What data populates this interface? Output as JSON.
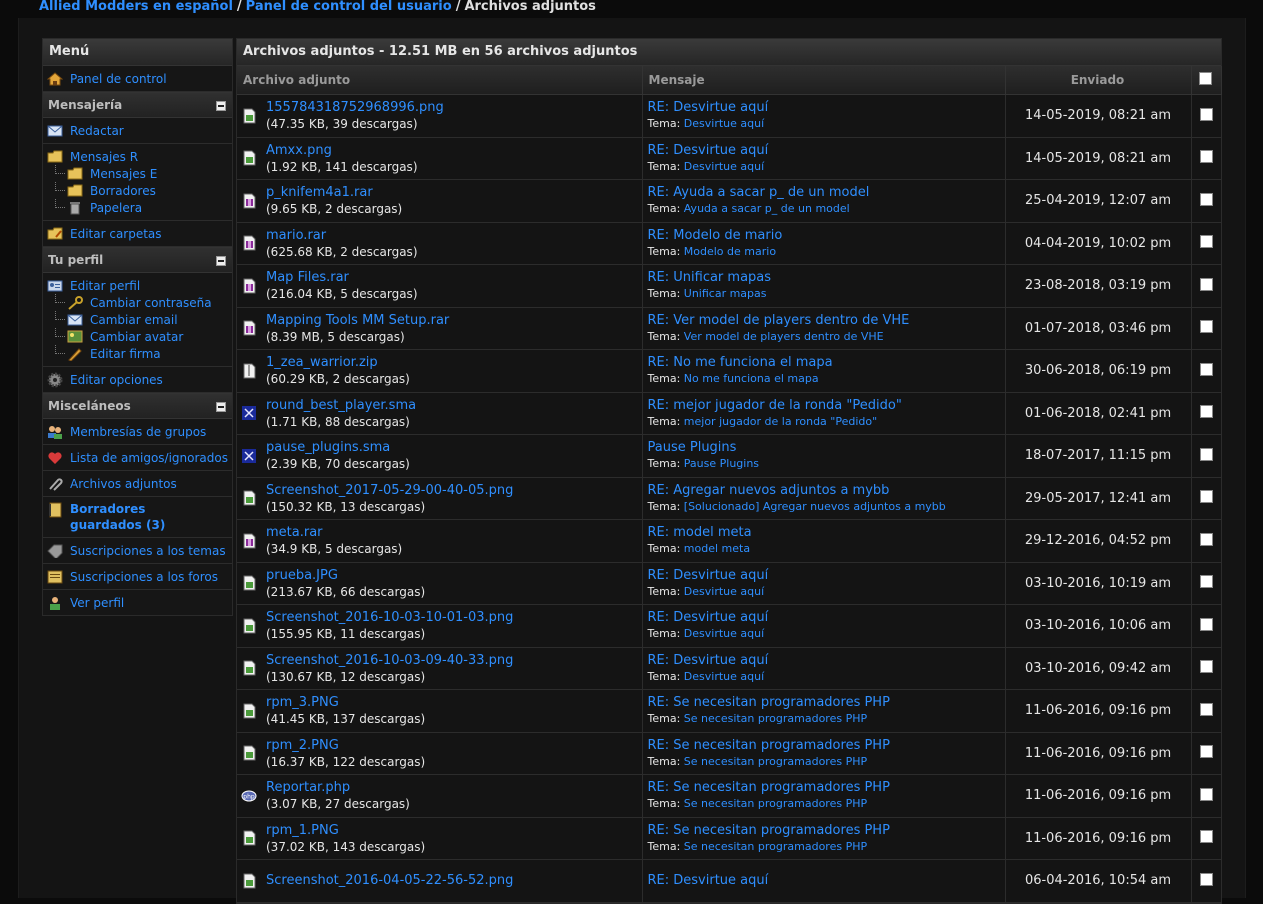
{
  "breadcrumb": [
    "Allied Modders en español",
    "Panel de control del usuario",
    "Archivos adjuntos"
  ],
  "sidebar": {
    "title": "Menú",
    "panel": "Panel de control",
    "messaging": {
      "title": "Mensajería",
      "compose": "Redactar",
      "inbox": "Mensajes R",
      "sent": "Mensajes E",
      "drafts": "Borradores",
      "trash": "Papelera",
      "edit_folders": "Editar carpetas"
    },
    "profile": {
      "title": "Tu perfil",
      "edit_profile": "Editar perfil",
      "change_password": "Cambiar contraseña",
      "change_email": "Cambiar email",
      "change_avatar": "Cambiar avatar",
      "edit_signature": "Editar firma",
      "edit_options": "Editar opciones"
    },
    "misc": {
      "title": "Misceláneos",
      "group_memberships": "Membresías de grupos",
      "friends": "Lista de amigos/ignorados",
      "attachments": "Archivos adjuntos",
      "saved_drafts": "Borradores guardados (3)",
      "thread_subs": "Suscripciones a los temas",
      "forum_subs": "Suscripciones a los foros",
      "view_profile": "Ver perfil"
    }
  },
  "main": {
    "title": "Archivos adjuntos - 12.51 MB en 56 archivos adjuntos",
    "columns": {
      "file": "Archivo adjunto",
      "message": "Mensaje",
      "sent": "Enviado"
    },
    "topic_label": "Tema:",
    "rows": [
      {
        "icon": "image",
        "name": "155784318752968996.png",
        "meta": "(47.35 KB, 39 descargas)",
        "message": "RE: Desvirtue aquí",
        "topic": "Desvirtue aquí",
        "date": "14-05-2019, 08:21 am"
      },
      {
        "icon": "image",
        "name": "Amxx.png",
        "meta": "(1.92 KB, 141 descargas)",
        "message": "RE: Desvirtue aquí",
        "topic": "Desvirtue aquí",
        "date": "14-05-2019, 08:21 am"
      },
      {
        "icon": "archive",
        "name": "p_knifem4a1.rar",
        "meta": "(9.65 KB, 2 descargas)",
        "message": "RE: Ayuda a sacar p_ de un model",
        "topic": "Ayuda a sacar p_ de un model",
        "date": "25-04-2019, 12:07 am"
      },
      {
        "icon": "archive",
        "name": "mario.rar",
        "meta": "(625.68 KB, 2 descargas)",
        "message": "RE: Modelo de mario",
        "topic": "Modelo de mario",
        "date": "04-04-2019, 10:02 pm"
      },
      {
        "icon": "archive",
        "name": "Map Files.rar",
        "meta": "(216.04 KB, 5 descargas)",
        "message": "RE: Unificar mapas",
        "topic": "Unificar mapas",
        "date": "23-08-2018, 03:19 pm"
      },
      {
        "icon": "archive",
        "name": "Mapping Tools MM Setup.rar",
        "meta": "(8.39 MB, 5 descargas)",
        "message": "RE: Ver model de players dentro de VHE",
        "topic": "Ver model de players dentro de VHE",
        "date": "01-07-2018, 03:46 pm"
      },
      {
        "icon": "zip",
        "name": "1_zea_warrior.zip",
        "meta": "(60.29 KB, 2 descargas)",
        "message": "RE: No me funciona el mapa",
        "topic": "No me funciona el mapa",
        "date": "30-06-2018, 06:19 pm"
      },
      {
        "icon": "sma",
        "name": "round_best_player.sma",
        "meta": "(1.71 KB, 88 descargas)",
        "message": "RE: mejor jugador de la ronda \"Pedido\"",
        "topic": "mejor jugador de la ronda \"Pedido\"",
        "date": "01-06-2018, 02:41 pm"
      },
      {
        "icon": "sma",
        "name": "pause_plugins.sma",
        "meta": "(2.39 KB, 70 descargas)",
        "message": "Pause Plugins",
        "topic": "Pause Plugins",
        "date": "18-07-2017, 11:15 pm"
      },
      {
        "icon": "image",
        "name": "Screenshot_2017-05-29-00-40-05.png",
        "meta": "(150.32 KB, 13 descargas)",
        "message": "RE: Agregar nuevos adjuntos a mybb",
        "topic": "[Solucionado] Agregar nuevos adjuntos a mybb",
        "date": "29-05-2017, 12:41 am"
      },
      {
        "icon": "archive",
        "name": "meta.rar",
        "meta": "(34.9 KB, 5 descargas)",
        "message": "RE: model meta",
        "topic": "model meta",
        "date": "29-12-2016, 04:52 pm"
      },
      {
        "icon": "image",
        "name": "prueba.JPG",
        "meta": "(213.67 KB, 66 descargas)",
        "message": "RE: Desvirtue aquí",
        "topic": "Desvirtue aquí",
        "date": "03-10-2016, 10:19 am"
      },
      {
        "icon": "image",
        "name": "Screenshot_2016-10-03-10-01-03.png",
        "meta": "(155.95 KB, 11 descargas)",
        "message": "RE: Desvirtue aquí",
        "topic": "Desvirtue aquí",
        "date": "03-10-2016, 10:06 am"
      },
      {
        "icon": "image",
        "name": "Screenshot_2016-10-03-09-40-33.png",
        "meta": "(130.67 KB, 12 descargas)",
        "message": "RE: Desvirtue aquí",
        "topic": "Desvirtue aquí",
        "date": "03-10-2016, 09:42 am"
      },
      {
        "icon": "image",
        "name": "rpm_3.PNG",
        "meta": "(41.45 KB, 137 descargas)",
        "message": "RE: Se necesitan programadores PHP",
        "topic": "Se necesitan programadores PHP",
        "date": "11-06-2016, 09:16 pm"
      },
      {
        "icon": "image",
        "name": "rpm_2.PNG",
        "meta": "(16.37 KB, 122 descargas)",
        "message": "RE: Se necesitan programadores PHP",
        "topic": "Se necesitan programadores PHP",
        "date": "11-06-2016, 09:16 pm"
      },
      {
        "icon": "php",
        "name": "Reportar.php",
        "meta": "(3.07 KB, 27 descargas)",
        "message": "RE: Se necesitan programadores PHP",
        "topic": "Se necesitan programadores PHP",
        "date": "11-06-2016, 09:16 pm"
      },
      {
        "icon": "image",
        "name": "rpm_1.PNG",
        "meta": "(37.02 KB, 143 descargas)",
        "message": "RE: Se necesitan programadores PHP",
        "topic": "Se necesitan programadores PHP",
        "date": "11-06-2016, 09:16 pm"
      },
      {
        "icon": "image",
        "name": "Screenshot_2016-04-05-22-56-52.png",
        "meta": "",
        "message": "RE: Desvirtue aquí",
        "topic": "",
        "date": "06-04-2016, 10:54 am"
      }
    ]
  }
}
